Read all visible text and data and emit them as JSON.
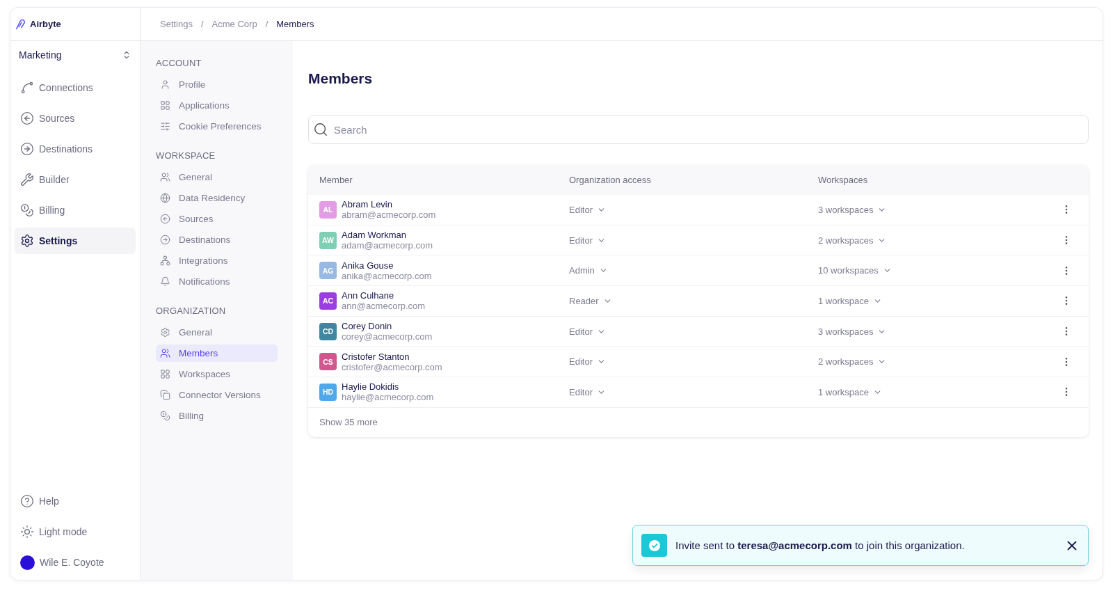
{
  "brand": {
    "name": "Airbyte"
  },
  "breadcrumb": [
    {
      "label": "Settings",
      "current": false
    },
    {
      "separator": "/",
      "label": "Acme Corp",
      "current": false
    },
    {
      "separator": "/",
      "label": "Members",
      "current": true
    }
  ],
  "workspace_selector": {
    "value": "Marketing"
  },
  "sidebar": {
    "items": [
      {
        "label": "Connections",
        "kind": "connections",
        "selected": false
      },
      {
        "label": "Sources",
        "kind": "sources",
        "selected": false
      },
      {
        "label": "Destinations",
        "kind": "destinations",
        "selected": false
      },
      {
        "label": "Builder",
        "kind": "builder",
        "selected": false
      },
      {
        "label": "Billing",
        "kind": "billing",
        "selected": false
      },
      {
        "label": "Settings",
        "kind": "settings",
        "selected": true
      }
    ],
    "footer": [
      {
        "label": "Help",
        "kind": "help"
      },
      {
        "label": "Light mode",
        "kind": "theme"
      }
    ],
    "user": {
      "name": "Wile E. Coyote"
    }
  },
  "settings_nav": [
    {
      "title": "ACCOUNT",
      "items": [
        {
          "label": "Profile",
          "kind": "user",
          "selected": false
        },
        {
          "label": "Applications",
          "kind": "grid",
          "selected": false
        },
        {
          "label": "Cookie Preferences",
          "kind": "sliders",
          "selected": false
        }
      ]
    },
    {
      "title": "WORKSPACE",
      "items": [
        {
          "label": "General",
          "kind": "users",
          "selected": false
        },
        {
          "label": "Data Residency",
          "kind": "globe",
          "selected": false
        },
        {
          "label": "Sources",
          "kind": "sources",
          "selected": false
        },
        {
          "label": "Destinations",
          "kind": "destinations",
          "selected": false
        },
        {
          "label": "Integrations",
          "kind": "network",
          "selected": false
        },
        {
          "label": "Notifications",
          "kind": "bell",
          "selected": false
        }
      ]
    },
    {
      "title": "ORGANIZATION",
      "items": [
        {
          "label": "General",
          "kind": "gear",
          "selected": false
        },
        {
          "label": "Members",
          "kind": "users",
          "selected": true
        },
        {
          "label": "Workspaces",
          "kind": "grid",
          "selected": false
        },
        {
          "label": "Connector Versions",
          "kind": "copy",
          "selected": false
        },
        {
          "label": "Billing",
          "kind": "billing",
          "selected": false
        }
      ]
    }
  ],
  "page": {
    "title": "Members"
  },
  "search": {
    "placeholder": "Search"
  },
  "table": {
    "columns": [
      "Member",
      "Organization access",
      "Workspaces"
    ],
    "rows": [
      {
        "initials": "AL",
        "color": "#e29ce3",
        "name": "Abram Levin",
        "email": "abram@acmecorp.com",
        "access": "Editor",
        "workspaces": "3 workspaces"
      },
      {
        "initials": "AW",
        "color": "#7fcfb5",
        "name": "Adam Workman",
        "email": "adam@acmecorp.com",
        "access": "Editor",
        "workspaces": "2 workspaces"
      },
      {
        "initials": "AG",
        "color": "#97b9e3",
        "name": "Anika Gouse",
        "email": "anika@acmecorp.com",
        "access": "Admin",
        "workspaces": "10 workspaces"
      },
      {
        "initials": "AC",
        "color": "#9b3ee0",
        "name": "Ann Culhane",
        "email": "ann@acmecorp.com",
        "access": "Reader",
        "workspaces": "1 workspace"
      },
      {
        "initials": "CD",
        "color": "#3f86a0",
        "name": "Corey Donin",
        "email": "corey@acmecorp.com",
        "access": "Editor",
        "workspaces": "3 workspaces"
      },
      {
        "initials": "CS",
        "color": "#d0588e",
        "name": "Cristofer Stanton",
        "email": "cristofer@acmecorp.com",
        "access": "Editor",
        "workspaces": "2 workspaces"
      },
      {
        "initials": "HD",
        "color": "#4fa8ea",
        "name": "Haylie Dokidis",
        "email": "haylie@acmecorp.com",
        "access": "Editor",
        "workspaces": "1 workspace"
      }
    ],
    "show_more": "Show 35 more"
  },
  "toast": {
    "message": "Invite sent to **teresa@acmecorp.com** to join this organization."
  }
}
